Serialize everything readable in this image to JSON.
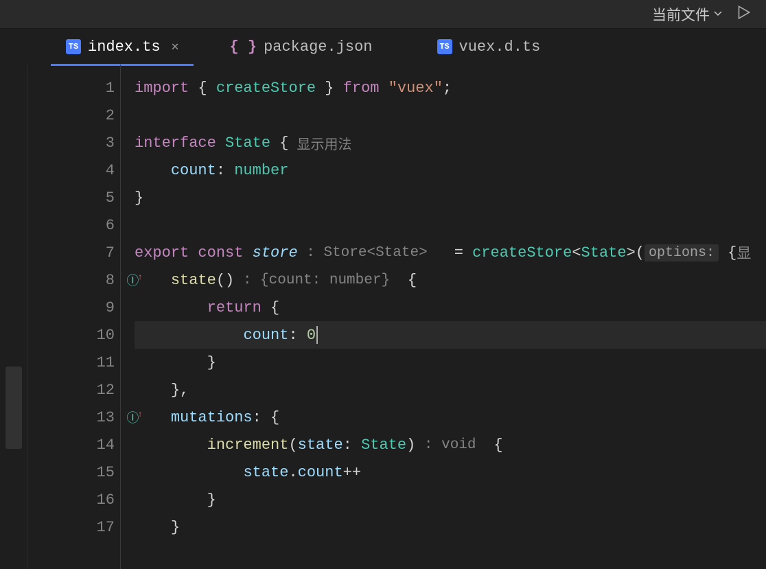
{
  "toolbar": {
    "scope_label": "当前文件"
  },
  "tabs": [
    {
      "label": "index.ts",
      "icon": "ts",
      "active": true,
      "close": true
    },
    {
      "label": "package.json",
      "icon": "json",
      "active": false,
      "close": false
    },
    {
      "label": "vuex.d.ts",
      "icon": "ts",
      "active": false,
      "close": false
    }
  ],
  "line_numbers": [
    "1",
    "2",
    "3",
    "4",
    "5",
    "6",
    "7",
    "8",
    "9",
    "10",
    "11",
    "12",
    "13",
    "14",
    "15",
    "16",
    "17"
  ],
  "code": {
    "l1": {
      "import": "import",
      "brace_l": " { ",
      "createStore": "createStore",
      "brace_r": " } ",
      "from": "from",
      "sp": " ",
      "vuex": "\"vuex\"",
      "semi": ";"
    },
    "l3": {
      "interface": "interface",
      "sp": " ",
      "State": "State",
      "sp2": " ",
      "brace": "{",
      "usage": "显示用法"
    },
    "l4": {
      "count": "count",
      "colon": ": ",
      "number": "number"
    },
    "l5": {
      "brace": "}"
    },
    "l7": {
      "export": "export",
      "sp": " ",
      "const": "const",
      "sp2": " ",
      "store": "store",
      "hint_type": " : Store<State> ",
      "eq": "  = ",
      "createStore": "createStore",
      "lt": "<",
      "State": "State",
      "gt": ">(",
      "options_label": "options:",
      "brace": " {",
      "more": "显"
    },
    "l8": {
      "state": "state",
      "paren": "()",
      "hint": " : {count: number} ",
      "brace": " {"
    },
    "l9": {
      "return": "return",
      "brace": " {"
    },
    "l10": {
      "count": "count",
      "colon": ": ",
      "zero": "0"
    },
    "l11": {
      "brace": "}"
    },
    "l12": {
      "brace": "},"
    },
    "l13": {
      "mutations": "mutations",
      "colon": ": ",
      "brace": "{"
    },
    "l14": {
      "increment": "increment",
      "paren_l": "(",
      "state_p": "state",
      "colon": ": ",
      "State": "State",
      "paren_r": ")",
      "hint": " : void ",
      "brace": " {"
    },
    "l15": {
      "state": "state",
      "dot": ".",
      "count": "count",
      "inc": "++"
    },
    "l16": {
      "brace": "}"
    },
    "l17": {
      "brace": "}"
    }
  }
}
